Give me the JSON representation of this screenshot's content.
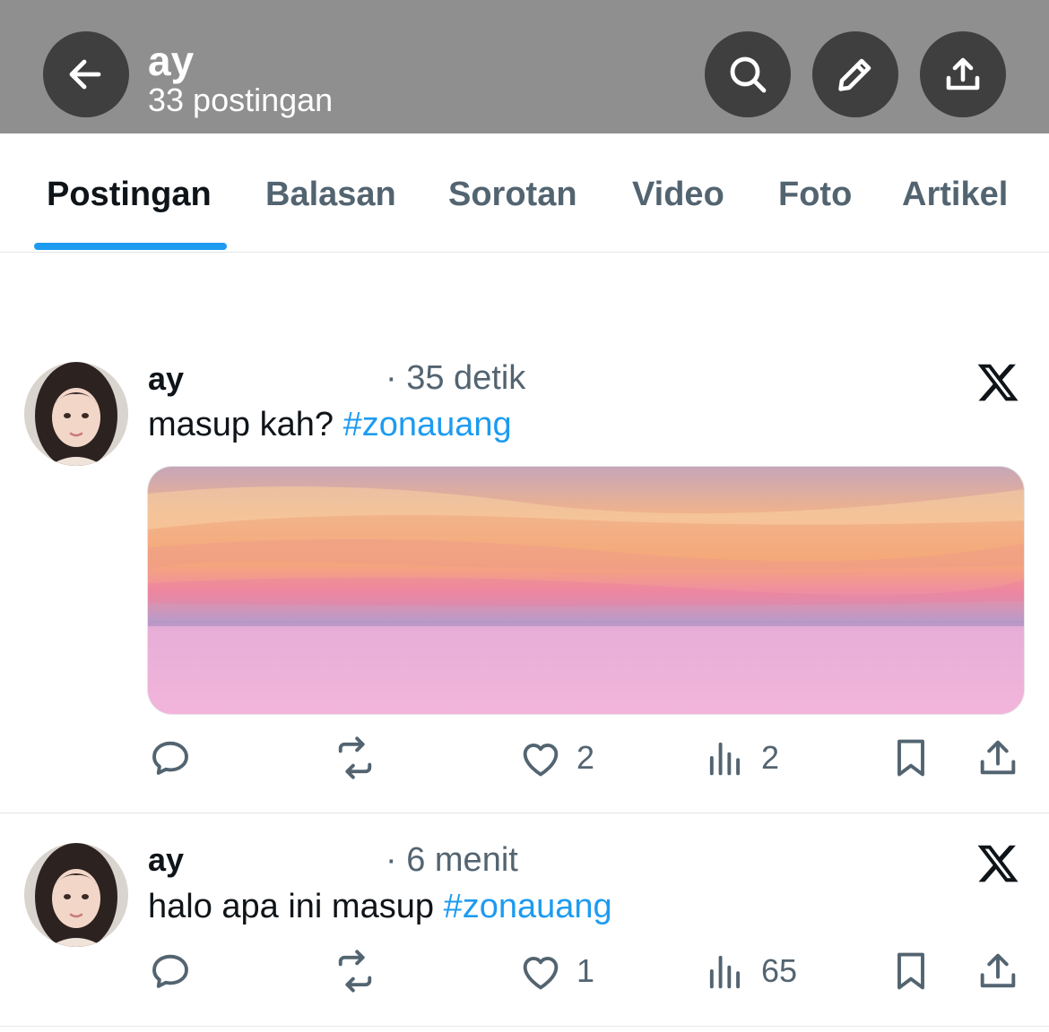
{
  "header": {
    "name": "ay",
    "post_count": "33 postingan",
    "icons": [
      "back-arrow-icon",
      "search-icon",
      "pencil-icon",
      "share-icon"
    ],
    "bg_color": "#8f8f8f"
  },
  "tabs": [
    "Postingan",
    "Balasan",
    "Sorotan",
    "Video",
    "Foto",
    "Artikel"
  ],
  "active_tab": "Postingan",
  "accent_color": "#1d9bf0",
  "posts": [
    {
      "author": "ay",
      "time": "· 35 detik",
      "text": "masup kah? ",
      "hashtag": "#zonauang",
      "has_image": true,
      "likes": "2",
      "views": "2"
    },
    {
      "author": "ay",
      "time": "· 6 menit",
      "text": "halo apa ini masup ",
      "hashtag": "#zonauang",
      "has_image": false,
      "likes": "1",
      "views": "65"
    }
  ]
}
